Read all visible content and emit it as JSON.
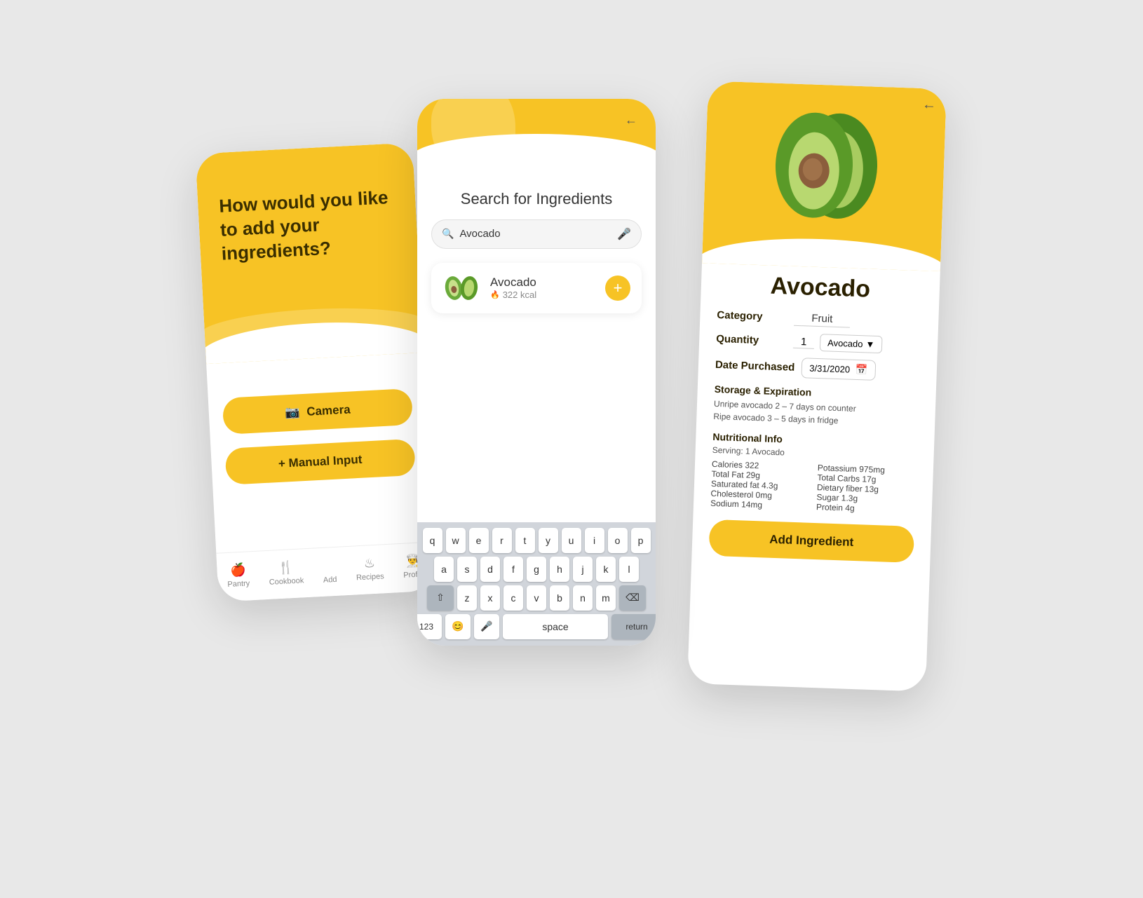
{
  "phones": {
    "left": {
      "question": "How would you like to add your ingredients?",
      "camera_btn": "Camera",
      "manual_btn": "+ Manual Input",
      "nav": {
        "items": [
          {
            "label": "Pantry",
            "icon": "🍎"
          },
          {
            "label": "Cookbook",
            "icon": "🍴"
          },
          {
            "label": "Add",
            "icon": "+",
            "active": true
          },
          {
            "label": "Recipes",
            "icon": "♨"
          },
          {
            "label": "Profile",
            "icon": "👨‍🍳"
          }
        ]
      }
    },
    "middle": {
      "title": "Search for Ingredients",
      "search_placeholder": "Avocado",
      "search_value": "Avocado",
      "back_arrow": "←",
      "result": {
        "name": "Avocado",
        "calories": "322 kcal",
        "add_btn": "+"
      },
      "keyboard": {
        "row1": [
          "w",
          "e",
          "r",
          "t",
          "y",
          "u",
          "i",
          "o",
          "p"
        ],
        "row2": [
          "s",
          "d",
          "f",
          "g",
          "h",
          "j",
          "k",
          "l"
        ],
        "row3": [
          "z",
          "x",
          "c",
          "v",
          "b",
          "n",
          "m"
        ],
        "bottom": [
          "123",
          "😊",
          "🎤",
          "space",
          "return"
        ]
      }
    },
    "right": {
      "back_arrow": "←",
      "title": "Avocado",
      "category_label": "Category",
      "category_value": "Fruit",
      "quantity_label": "Quantity",
      "quantity_value": "1",
      "unit_value": "Avocado",
      "date_label": "Date Purchased",
      "date_value": "3/31/2020",
      "storage_title": "Storage & Expiration",
      "storage_text": "Unripe avocado 2 – 7 days on counter\nRipe avocado 3 – 5 days in fridge",
      "nutrition_title": "Nutritional Info",
      "nutrition_serving": "Serving: 1 Avocado",
      "nutrition_left": [
        "Calories 322",
        "Total Fat 29g",
        "Saturated fat 4.3g",
        "Cholesterol 0mg",
        "Sodium 14mg"
      ],
      "nutrition_right": [
        "Potassium 975mg",
        "Total Carbs 17g",
        "Dietary fiber 13g",
        "Sugar 1.3g",
        "Protein 4g"
      ],
      "add_btn": "Add Ingredient"
    }
  }
}
